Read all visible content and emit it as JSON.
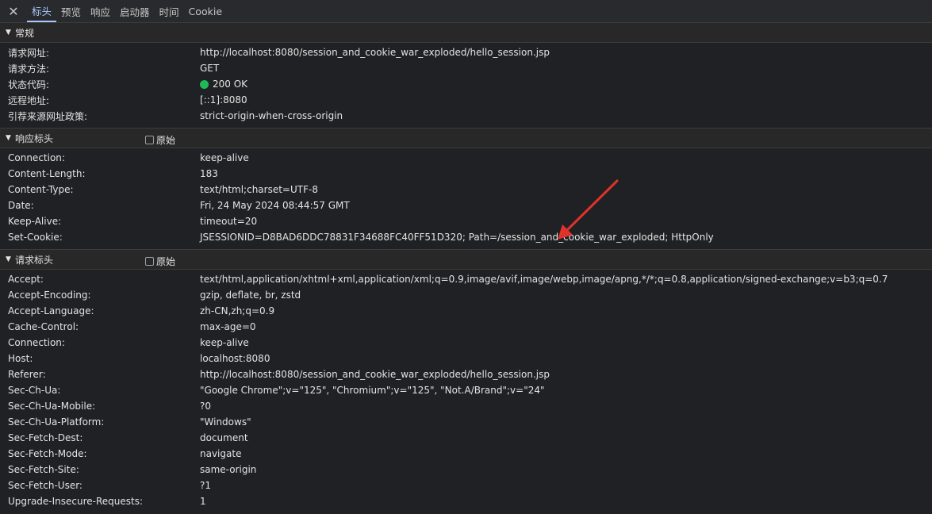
{
  "tabs": {
    "close_icon": "✕",
    "items": [
      "标头",
      "预览",
      "响应",
      "启动器",
      "时间",
      "Cookie"
    ],
    "active": "标头"
  },
  "general": {
    "title": "常规",
    "rows": [
      {
        "key": "请求网址:",
        "value": "http://localhost:8080/session_and_cookie_war_exploded/hello_session.jsp"
      },
      {
        "key": "请求方法:",
        "value": "GET"
      },
      {
        "key": "状态代码:",
        "value": "200 OK",
        "status_color": "#1fb95a"
      },
      {
        "key": "远程地址:",
        "value": "[::1]:8080"
      },
      {
        "key": "引荐来源网址政策:",
        "value": "strict-origin-when-cross-origin"
      }
    ]
  },
  "response_headers": {
    "title": "响应标头",
    "raw_label": "原始",
    "rows": [
      {
        "key": "Connection:",
        "value": "keep-alive"
      },
      {
        "key": "Content-Length:",
        "value": "183"
      },
      {
        "key": "Content-Type:",
        "value": "text/html;charset=UTF-8"
      },
      {
        "key": "Date:",
        "value": "Fri, 24 May 2024 08:44:57 GMT"
      },
      {
        "key": "Keep-Alive:",
        "value": "timeout=20"
      },
      {
        "key": "Set-Cookie:",
        "value": "JSESSIONID=D8BAD6DDC78831F34688FC40FF51D320; Path=/session_and_cookie_war_exploded; HttpOnly"
      }
    ]
  },
  "request_headers": {
    "title": "请求标头",
    "raw_label": "原始",
    "rows": [
      {
        "key": "Accept:",
        "value": "text/html,application/xhtml+xml,application/xml;q=0.9,image/avif,image/webp,image/apng,*/*;q=0.8,application/signed-exchange;v=b3;q=0.7"
      },
      {
        "key": "Accept-Encoding:",
        "value": "gzip, deflate, br, zstd"
      },
      {
        "key": "Accept-Language:",
        "value": "zh-CN,zh;q=0.9"
      },
      {
        "key": "Cache-Control:",
        "value": "max-age=0"
      },
      {
        "key": "Connection:",
        "value": "keep-alive"
      },
      {
        "key": "Host:",
        "value": "localhost:8080"
      },
      {
        "key": "Referer:",
        "value": "http://localhost:8080/session_and_cookie_war_exploded/hello_session.jsp"
      },
      {
        "key": "Sec-Ch-Ua:",
        "value": "\"Google Chrome\";v=\"125\", \"Chromium\";v=\"125\", \"Not.A/Brand\";v=\"24\""
      },
      {
        "key": "Sec-Ch-Ua-Mobile:",
        "value": "?0"
      },
      {
        "key": "Sec-Ch-Ua-Platform:",
        "value": "\"Windows\""
      },
      {
        "key": "Sec-Fetch-Dest:",
        "value": "document"
      },
      {
        "key": "Sec-Fetch-Mode:",
        "value": "navigate"
      },
      {
        "key": "Sec-Fetch-Site:",
        "value": "same-origin"
      },
      {
        "key": "Sec-Fetch-User:",
        "value": "?1"
      },
      {
        "key": "Upgrade-Insecure-Requests:",
        "value": "1"
      }
    ]
  },
  "colors": {
    "accent": "#a8c7fa",
    "annotation_arrow": "#e0322b"
  }
}
